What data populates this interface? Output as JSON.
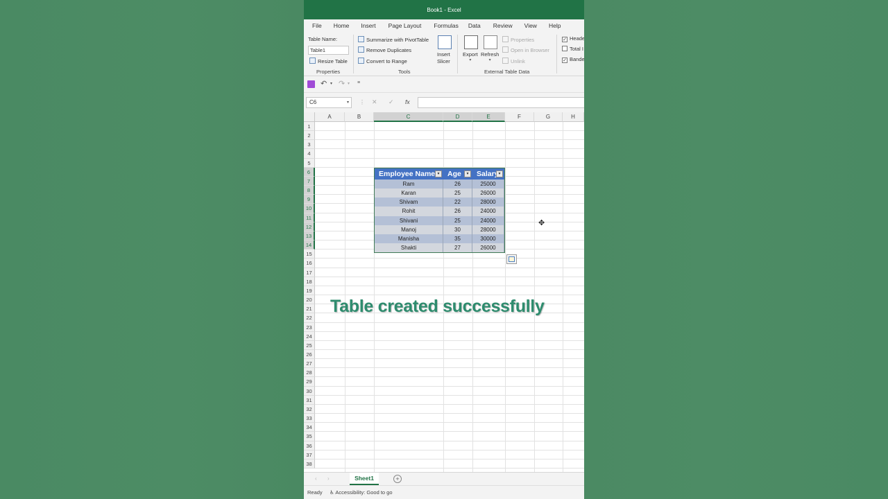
{
  "window": {
    "title": "Book1  -  Excel"
  },
  "menu": [
    "File",
    "Home",
    "Insert",
    "Page Layout",
    "Formulas",
    "Data",
    "Review",
    "View",
    "Help"
  ],
  "ribbon": {
    "properties": {
      "table_name_label": "Table Name:",
      "table_name_value": "Table1",
      "resize_table": "Resize Table",
      "group_label": "Properties"
    },
    "tools": {
      "summarize_pivot": "Summarize with PivotTable",
      "remove_duplicates": "Remove Duplicates",
      "convert_to_range": "Convert to Range",
      "insert_slicer_line1": "Insert",
      "insert_slicer_line2": "Slicer",
      "group_label": "Tools"
    },
    "external": {
      "export": "Export",
      "refresh": "Refresh",
      "properties": "Properties",
      "open_in_browser": "Open in Browser",
      "unlink": "Unlink",
      "group_label": "External Table Data"
    },
    "style_options": {
      "header_row": "Heade",
      "total_row": "Total I",
      "banded_rows": "Bande"
    }
  },
  "formula_bar": {
    "name_box": "C6",
    "formula": "",
    "fx": "fx",
    "cancel": "✕",
    "enter": "✓"
  },
  "grid": {
    "columns": [
      "A",
      "B",
      "C",
      "D",
      "E",
      "F",
      "G",
      "H"
    ],
    "rows": [
      "1",
      "2",
      "3",
      "4",
      "5",
      "6",
      "7",
      "8",
      "9",
      "10",
      "11",
      "12",
      "13",
      "14",
      "15",
      "16",
      "17",
      "18",
      "19",
      "20",
      "21",
      "22",
      "23",
      "24",
      "25",
      "26",
      "27",
      "28",
      "29",
      "30",
      "31",
      "32",
      "33",
      "34",
      "35",
      "36",
      "37",
      "38"
    ],
    "selected_column": "C",
    "selected_row": "6"
  },
  "table": {
    "headers": [
      "Employee Name",
      "Age",
      "Salary"
    ],
    "rows": [
      [
        "Ram",
        "26",
        "25000"
      ],
      [
        "Karan",
        "25",
        "26000"
      ],
      [
        "Shivam",
        "22",
        "28000"
      ],
      [
        "Rohit",
        "26",
        "24000"
      ],
      [
        "Shivani",
        "25",
        "24000"
      ],
      [
        "Manoj",
        "30",
        "28000"
      ],
      [
        "Manisha",
        "35",
        "30000"
      ],
      [
        "Shakti",
        "27",
        "26000"
      ]
    ]
  },
  "overlay": {
    "caption": "Table created successfully"
  },
  "sheets": {
    "active": "Sheet1",
    "add": "+"
  },
  "status": {
    "ready": "Ready",
    "accessibility": "Accessibility: Good to go"
  },
  "colors": {
    "excel_green": "#217346",
    "table_header": "#4472c4",
    "band_dark": "#b4c0d6",
    "band_light": "#d3d7de",
    "caption": "#2e8c6e"
  }
}
